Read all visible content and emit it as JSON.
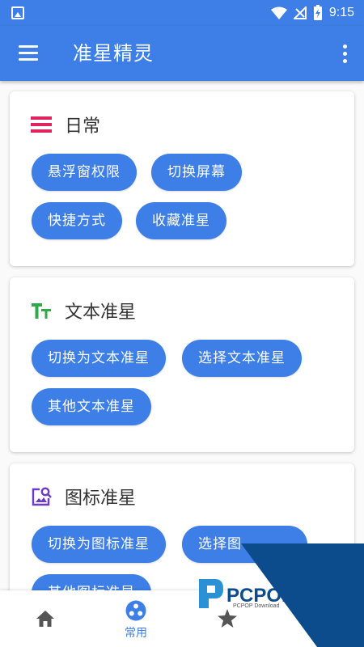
{
  "status_bar": {
    "time": "9:15"
  },
  "app_bar": {
    "title": "准星精灵"
  },
  "cards": [
    {
      "title": "日常",
      "icon": "list-icon",
      "buttons": [
        "悬浮窗权限",
        "切换屏幕",
        "快捷方式",
        "收藏准星"
      ]
    },
    {
      "title": "文本准星",
      "icon": "text-format-icon",
      "buttons": [
        "切换为文本准星",
        "选择文本准星",
        "其他文本准星"
      ]
    },
    {
      "title": "图标准星",
      "icon": "image-search-icon",
      "buttons": [
        "切换为图标准星",
        "选择图",
        "其他图标准星"
      ]
    }
  ],
  "bottom_nav": {
    "items": [
      {
        "icon": "home-icon",
        "label": ""
      },
      {
        "icon": "dots-icon",
        "label": "常用",
        "active": true
      },
      {
        "icon": "star-icon",
        "label": ""
      }
    ]
  },
  "watermark": {
    "brand": "PCPOP下载",
    "sub": "PCPOP Download"
  },
  "colors": {
    "primary": "#3d7fe6",
    "daily_icon": "#e0245e",
    "text_icon": "#2eaa4a",
    "image_icon": "#6a3cc9",
    "watermark": "#0d4c8c"
  }
}
